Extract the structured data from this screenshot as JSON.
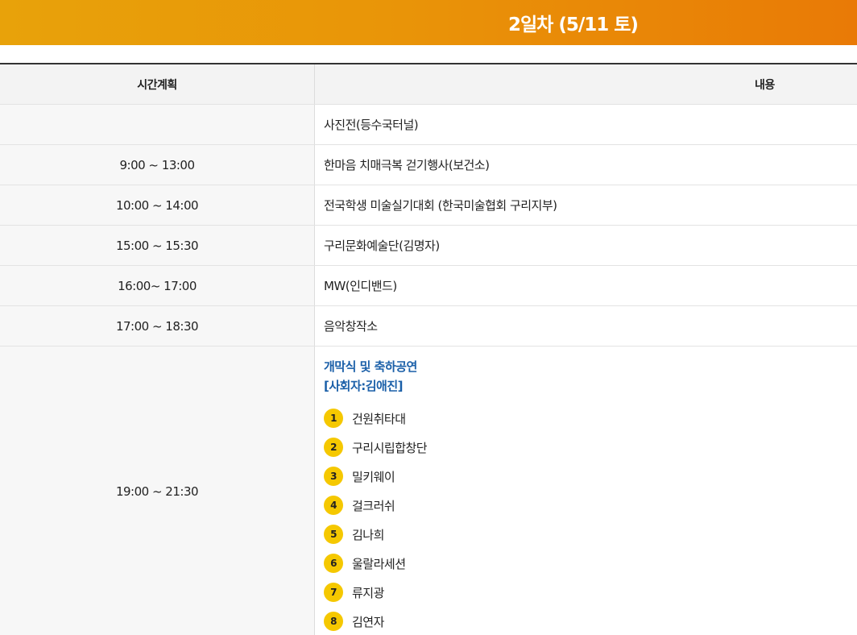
{
  "banner": {
    "title": "2일차 (5/11 토)"
  },
  "table": {
    "headers": {
      "time": "시간계획",
      "content": "내용"
    },
    "rows": [
      {
        "time": "",
        "content": "사진전(등수국터널)"
      },
      {
        "time": "9:00 ~ 13:00",
        "content": "한마음 치매극복 걷기행사(보건소)"
      },
      {
        "time": "10:00 ~ 14:00",
        "content": "전국학생 미술실기대회 (한국미술협회 구리지부)"
      },
      {
        "time": "15:00 ~ 15:30",
        "content": "구리문화예술단(김명자)"
      },
      {
        "time": "16:00~ 17:00",
        "content": "MW(인디밴드)"
      },
      {
        "time": "17:00 ~ 18:30",
        "content": "음악창작소"
      }
    ],
    "feature": {
      "time": "19:00 ~ 21:30",
      "title": "개막식 및 축하공연",
      "host": "[사회자:김애진]",
      "performers": [
        {
          "num": "1",
          "name": "건원취타대"
        },
        {
          "num": "2",
          "name": "구리시립합창단"
        },
        {
          "num": "3",
          "name": "밀키웨이"
        },
        {
          "num": "4",
          "name": "걸크러쉬"
        },
        {
          "num": "5",
          "name": "김나희"
        },
        {
          "num": "6",
          "name": "울랄라세션"
        },
        {
          "num": "7",
          "name": "류지광"
        },
        {
          "num": "8",
          "name": "김연자"
        }
      ]
    }
  },
  "colors": {
    "banner_start": "#e8a20a",
    "banner_end": "#e97a06",
    "badge": "#f5c800",
    "accent_text": "#1a5fa8"
  }
}
